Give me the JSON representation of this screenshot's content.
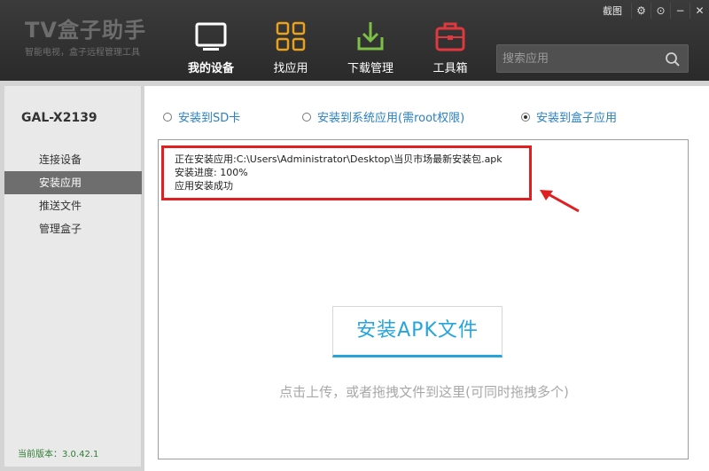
{
  "brand": {
    "title": "TV盒子助手",
    "subtitle": "智能电视，盒子远程管理工具"
  },
  "nav": [
    {
      "label": "我的设备",
      "icon": "tv-icon",
      "active": true
    },
    {
      "label": "找应用",
      "icon": "grid-icon",
      "active": false
    },
    {
      "label": "下载管理",
      "icon": "download-icon",
      "active": false
    },
    {
      "label": "工具箱",
      "icon": "toolbox-icon",
      "active": false
    }
  ],
  "window_controls": {
    "capture_label": "截图",
    "settings_icon": "⚙",
    "feedback_icon": "⊙",
    "minimize_icon": "−",
    "close_icon": "✕"
  },
  "search": {
    "placeholder": "搜索应用",
    "value": ""
  },
  "sidebar": {
    "device_name": "GAL-X2139",
    "items": [
      {
        "label": "连接设备",
        "active": false
      },
      {
        "label": "安装应用",
        "active": true
      },
      {
        "label": "推送文件",
        "active": false
      },
      {
        "label": "管理盒子",
        "active": false
      }
    ],
    "version": "当前版本：3.0.42.1"
  },
  "install_targets": [
    {
      "label": "安装到SD卡",
      "selected": false
    },
    {
      "label": "安装到系统应用(需root权限)",
      "selected": false
    },
    {
      "label": "安装到盒子应用",
      "selected": true
    }
  ],
  "log": {
    "line1": "正在安装应用:C:\\Users\\Administrator\\Desktop\\当贝市场最新安装包.apk",
    "line2": "安装进度:  100%",
    "line3": "应用安装成功"
  },
  "install_button": "安装APK文件",
  "hint": "点击上传，或者拖拽文件到这里(可同时拖拽多个)",
  "colors": {
    "accent": "#26a5dc",
    "highlight": "#e02020",
    "header_bg": "#2f2f2f",
    "active_menu": "#6e6e6e"
  }
}
